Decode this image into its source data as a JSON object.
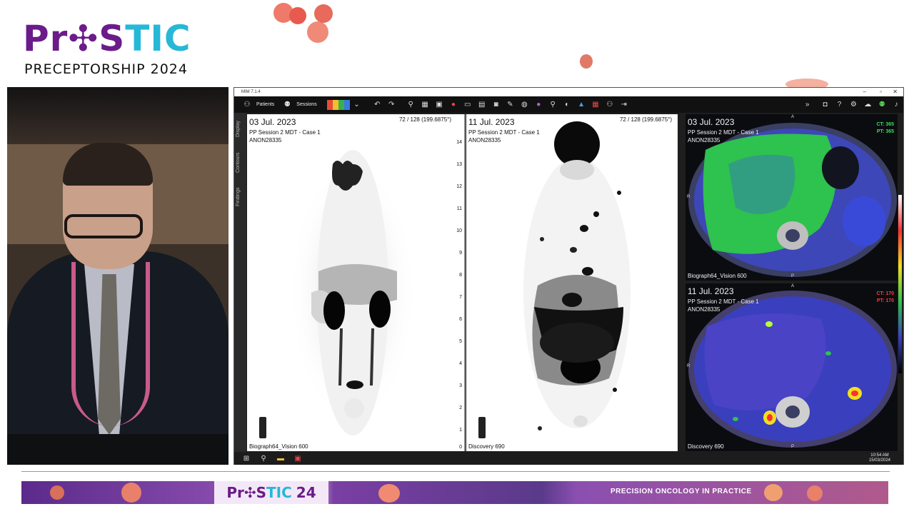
{
  "brand": {
    "logo_pros": "Pr",
    "logo_mid": "✣S",
    "logo_tic": "TIC",
    "subtitle": "PRECEPTORSHIP 2024"
  },
  "app": {
    "title": "MIM 7.1.4",
    "toolbar": {
      "patients_label": "Patients",
      "sessions_label": "Sessions"
    },
    "sidebar_tabs": [
      "Display",
      "Contours",
      "Findings"
    ],
    "viewports": [
      {
        "date": "03 Jul. 2023",
        "session": "PP Session 2 MDT - Case 1",
        "patient_id": "ANON28335",
        "slice": "72 / 128 (199.6875°)",
        "scanner": "Biograph64_Vision 600"
      },
      {
        "date": "11 Jul. 2023",
        "session": "PP Session 2 MDT - Case 1",
        "patient_id": "ANON28335",
        "slice": "72 / 128 (199.6875°)",
        "scanner": "Discovery 690"
      },
      {
        "date": "03 Jul. 2023",
        "session": "PP Session 2 MDT - Case 1",
        "patient_id": "ANON28335",
        "ct": "CT: 365",
        "pt": "PT: 365",
        "scanner": "Biograph64_Vision 600"
      },
      {
        "date": "11 Jul. 2023",
        "session": "PP Session 2 MDT - Case 1",
        "patient_id": "ANON28335",
        "ct": "CT: 170",
        "pt": "PT: 170",
        "scanner": "Discovery 690"
      }
    ],
    "ruler_ticks": [
      "14",
      "13",
      "12",
      "11",
      "10",
      "9",
      "8",
      "7",
      "6",
      "5",
      "4",
      "3",
      "2",
      "1",
      "0"
    ],
    "taskbar": {
      "time": "10:54 AM",
      "date": "15/03/2024"
    }
  },
  "banner": {
    "brand_pros": "Pr✣S",
    "brand_tic": "TIC",
    "brand_year": "24",
    "slogan": "PRECISION ONCOLOGY IN PRACTICE"
  },
  "colors": {
    "brand_purple": "#6b1b8a",
    "brand_cyan": "#26b8d6",
    "ct_green": "#33e05a",
    "pt_red": "#ff3b3b"
  }
}
